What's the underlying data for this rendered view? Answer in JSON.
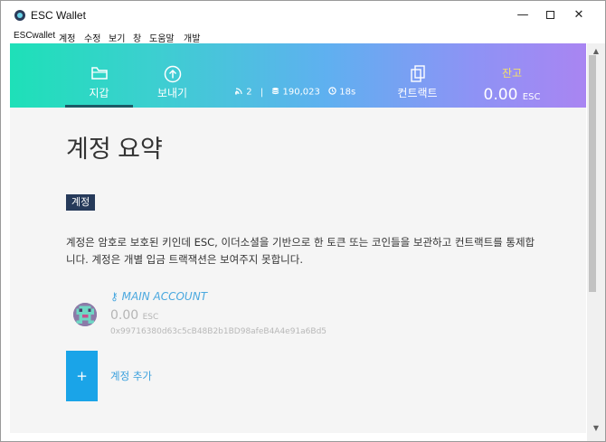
{
  "window": {
    "title": "ESC Wallet",
    "minimize": "—",
    "close": "✕"
  },
  "menu": [
    "ESCwallet",
    "계정",
    "수정",
    "보기",
    "창",
    "도움말",
    "개발"
  ],
  "nav": {
    "wallet": "지갑",
    "send": "보내기",
    "contracts": "컨트랙트"
  },
  "status": {
    "peers": "2",
    "separator": "|",
    "block": "190,023",
    "time": "18s"
  },
  "balance": {
    "label": "잔고",
    "value": "0.00",
    "unit": "ESC"
  },
  "page": {
    "title": "계정 요약",
    "section": "계정",
    "description": "계정은 암호로 보호된 키인데 ESC, 이더소셜을 기반으로 한 토큰 또는 코인들을 보관하고 컨트랙트를 통제합니다. 계정은 개별 입금 트랙잭션은 보여주지 못합니다."
  },
  "account": {
    "name": "MAIN ACCOUNT",
    "balance": "0.00",
    "unit": "ESC",
    "address": "0x99716380d63c5cB48B2b1BD98afeB4A4e91a6Bd5"
  },
  "add_account": {
    "plus": "+",
    "label": "계정 추가"
  },
  "colors": {
    "gradient_start": "#1ee0b8",
    "gradient_end": "#a985f2",
    "accent": "#1aa4e8",
    "badge": "#263a5a",
    "balance_label": "#f3e16b"
  },
  "icons": {
    "wallet": "folder-icon",
    "send": "arrow-up-circle-icon",
    "contracts": "documents-icon",
    "peers": "signal-icon",
    "block": "stack-icon",
    "time": "clock-icon",
    "account": "key-icon"
  }
}
